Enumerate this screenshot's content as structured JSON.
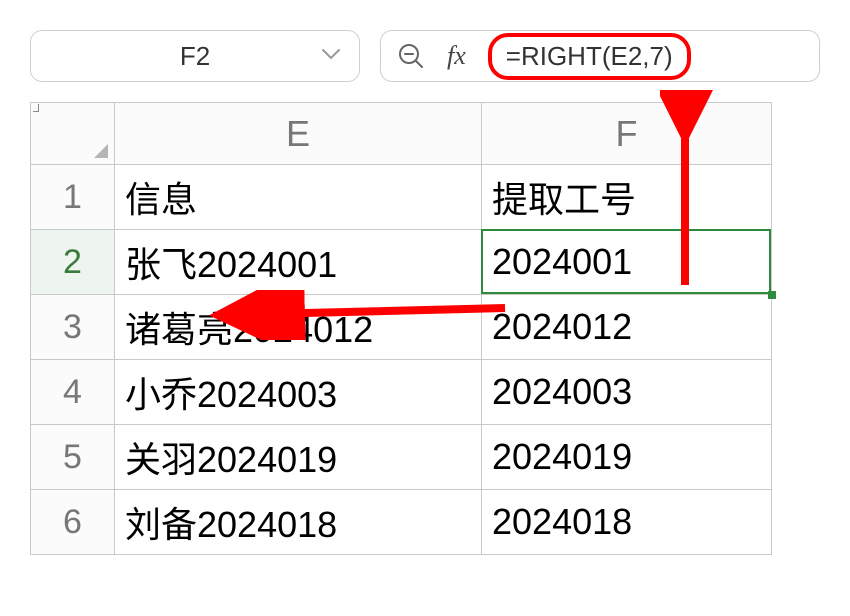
{
  "nameBox": {
    "value": "F2"
  },
  "formulaBar": {
    "fxLabel": "fx",
    "formula": "=RIGHT(E2,7)"
  },
  "columns": [
    "E",
    "F"
  ],
  "rowNumbers": [
    "1",
    "2",
    "3",
    "4",
    "5",
    "6"
  ],
  "cells": {
    "E1": "信息",
    "F1": "提取工号",
    "E2": "张飞2024001",
    "F2": "2024001",
    "E3": "诸葛亮2024012",
    "F3": "2024012",
    "E4": "小乔2024003",
    "F4": "2024003",
    "E5": "关羽2024019",
    "F5": "2024019",
    "E6": "刘备2024018",
    "F6": "2024018"
  },
  "selectedCell": "F2",
  "annotations": {
    "arrowColor": "#ff0000"
  }
}
